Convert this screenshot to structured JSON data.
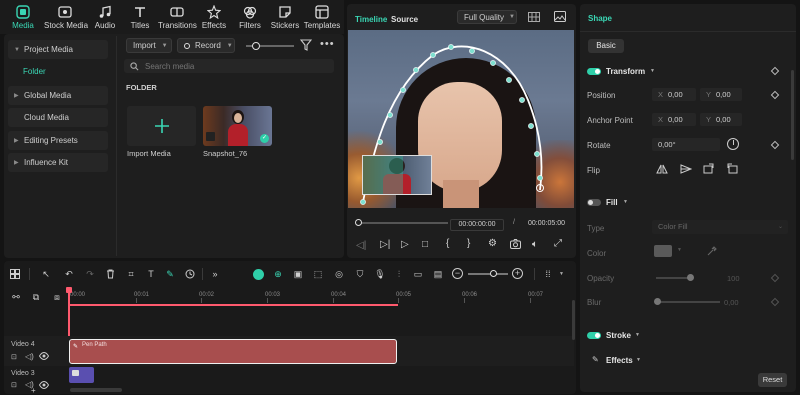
{
  "top_tabs": [
    {
      "label": "Media",
      "icon": "media-icon",
      "active": true
    },
    {
      "label": "Stock Media",
      "icon": "stock-media-icon"
    },
    {
      "label": "Audio",
      "icon": "music-note-icon"
    },
    {
      "label": "Titles",
      "icon": "titles-icon"
    },
    {
      "label": "Transitions",
      "icon": "transitions-icon"
    },
    {
      "label": "Effects",
      "icon": "effects-icon"
    },
    {
      "label": "Filters",
      "icon": "filters-icon"
    },
    {
      "label": "Stickers",
      "icon": "stickers-icon"
    },
    {
      "label": "Templates",
      "icon": "templates-icon"
    }
  ],
  "sidebar": {
    "items": [
      {
        "label": "Project Media",
        "expanded": true
      },
      {
        "label": "Folder",
        "selected": true
      },
      {
        "label": "Global Media"
      },
      {
        "label": "Cloud Media"
      },
      {
        "label": "Editing Presets"
      },
      {
        "label": "Influence Kit"
      }
    ]
  },
  "media": {
    "import_label": "Import",
    "record_label": "Record",
    "search_placeholder": "Search media",
    "folder_heading": "FOLDER",
    "import_tile_label": "Import Media",
    "clip_name": "Snapshot_76"
  },
  "player": {
    "tab_timeline": "Timeline",
    "tab_source": "Source",
    "quality": "Full Quality",
    "current_time": "00:00:00:00",
    "total_time": "00:00:05:00"
  },
  "right_panel": {
    "title": "Shape",
    "tab": "Basic",
    "transform_label": "Transform",
    "position_label": "Position",
    "position_x": "0,00",
    "position_y": "0,00",
    "anchor_label": "Anchor Point",
    "anchor_x": "0,00",
    "anchor_y": "0,00",
    "axis_x": "X",
    "axis_y": "Y",
    "rotate_label": "Rotate",
    "rotate_value": "0,00°",
    "flip_label": "Flip",
    "fill_label": "Fill",
    "type_label": "Type",
    "type_value": "Color Fill",
    "color_label": "Color",
    "opacity_label": "Opacity",
    "opacity_value": "100",
    "blur_label": "Blur",
    "blur_value": "0,00",
    "stroke_label": "Stroke",
    "effects_label": "Effects",
    "reset_label": "Reset"
  },
  "timeline": {
    "ruler": [
      "00:00",
      "00:01",
      "00:02",
      "00:03",
      "00:04",
      "00:05",
      "00:06",
      "00:07"
    ],
    "track_video4": "Video 4",
    "track_video3": "Video 3",
    "clip_label": "Pen Path"
  },
  "colors": {
    "accent": "#2fcfa9",
    "clip_red": "#a84e4e",
    "playhead": "#ff5a6e"
  }
}
